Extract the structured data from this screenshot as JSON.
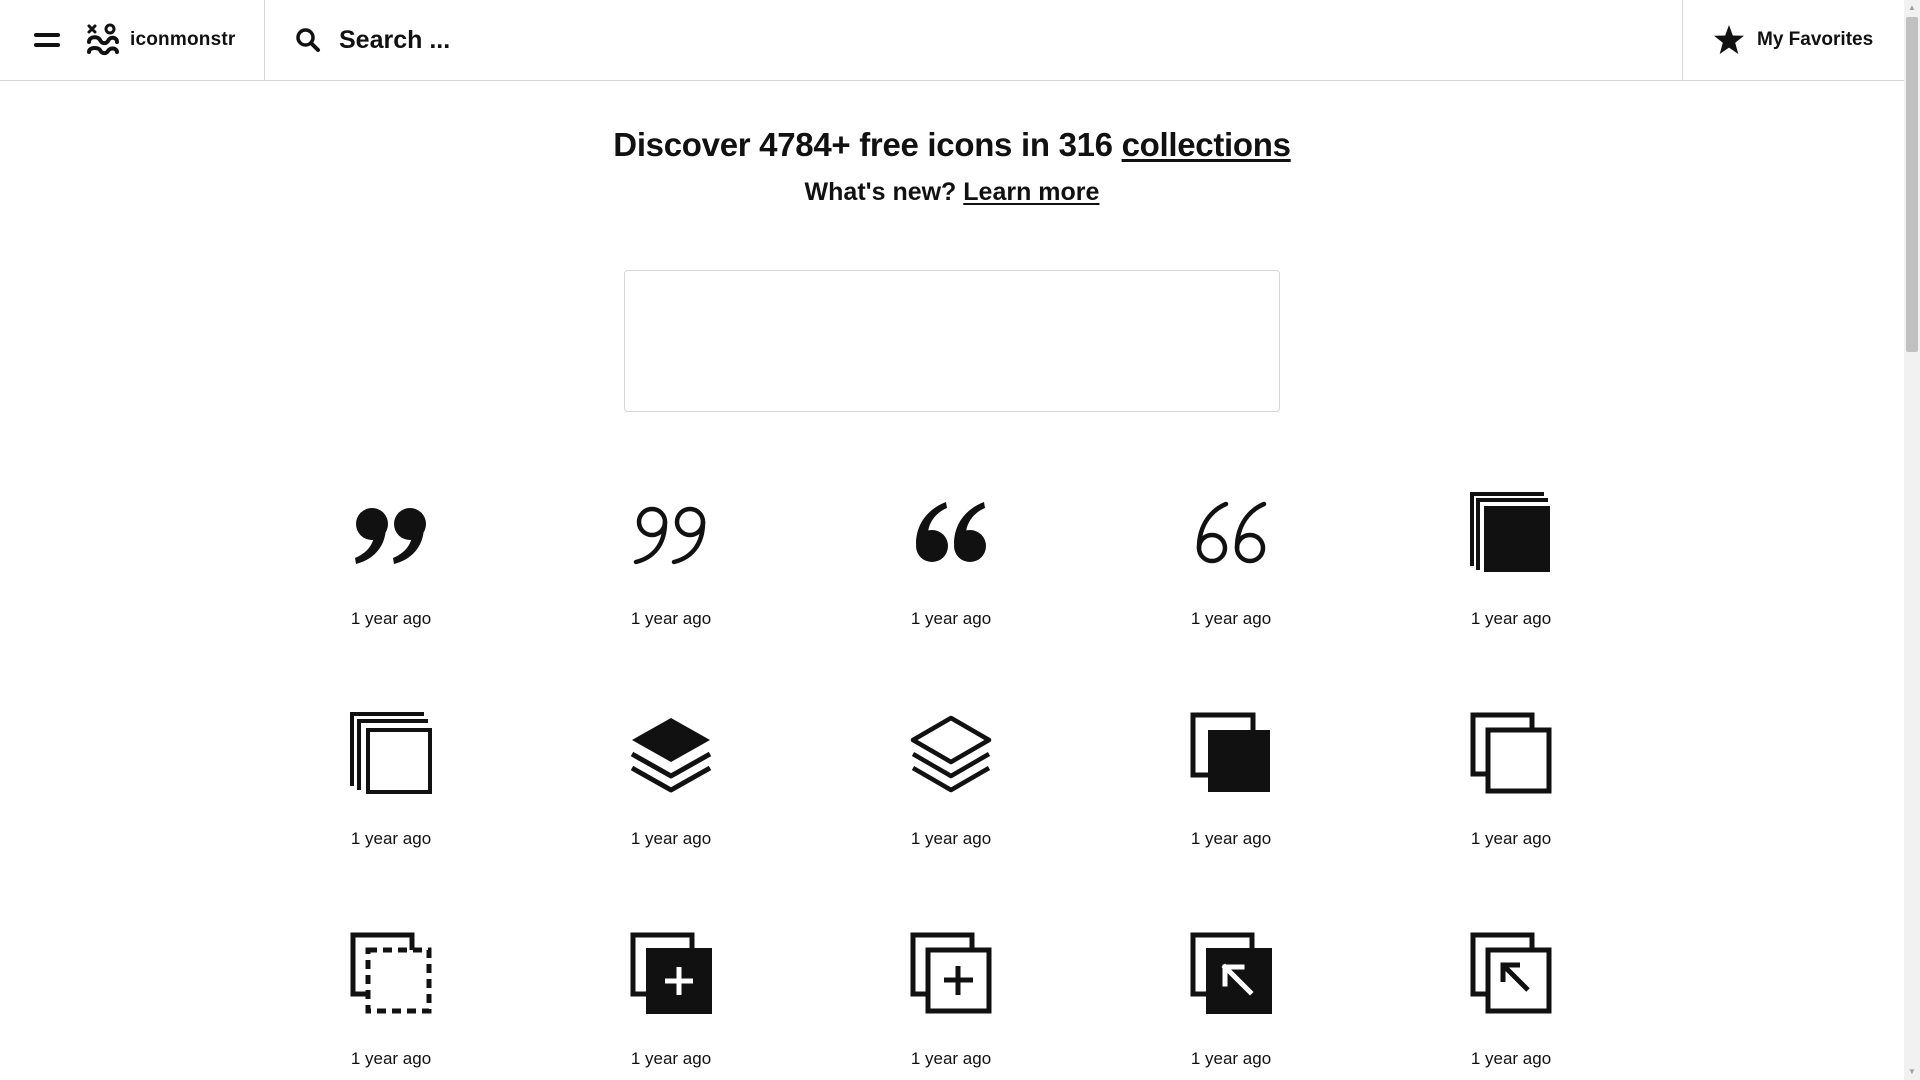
{
  "header": {
    "brand": "iconmonstr",
    "search_placeholder": "Search ...",
    "favorites_label": "My Favorites"
  },
  "hero": {
    "title_prefix": "Discover 4784+ free icons in 316 ",
    "title_link": "collections",
    "sub_prefix": "What's new? ",
    "sub_link": "Learn more"
  },
  "icons": [
    {
      "icon": "quote-close-filled-icon",
      "time": "1 year ago"
    },
    {
      "icon": "quote-close-outline-icon",
      "time": "1 year ago"
    },
    {
      "icon": "quote-open-filled-icon",
      "time": "1 year ago"
    },
    {
      "icon": "quote-open-outline-icon",
      "time": "1 year ago"
    },
    {
      "icon": "layers-stack-filled-icon",
      "time": "1 year ago"
    },
    {
      "icon": "layers-stack-outline-icon",
      "time": "1 year ago"
    },
    {
      "icon": "layers-filled-icon",
      "time": "1 year ago"
    },
    {
      "icon": "layers-outline-icon",
      "time": "1 year ago"
    },
    {
      "icon": "copy-filled-icon",
      "time": "1 year ago"
    },
    {
      "icon": "copy-outline-icon",
      "time": "1 year ago"
    },
    {
      "icon": "copy-dashed-icon",
      "time": "1 year ago"
    },
    {
      "icon": "copy-add-filled-icon",
      "time": "1 year ago"
    },
    {
      "icon": "copy-add-outline-icon",
      "time": "1 year ago"
    },
    {
      "icon": "copy-arrow-filled-icon",
      "time": "1 year ago"
    },
    {
      "icon": "copy-arrow-outline-icon",
      "time": "1 year ago"
    }
  ]
}
